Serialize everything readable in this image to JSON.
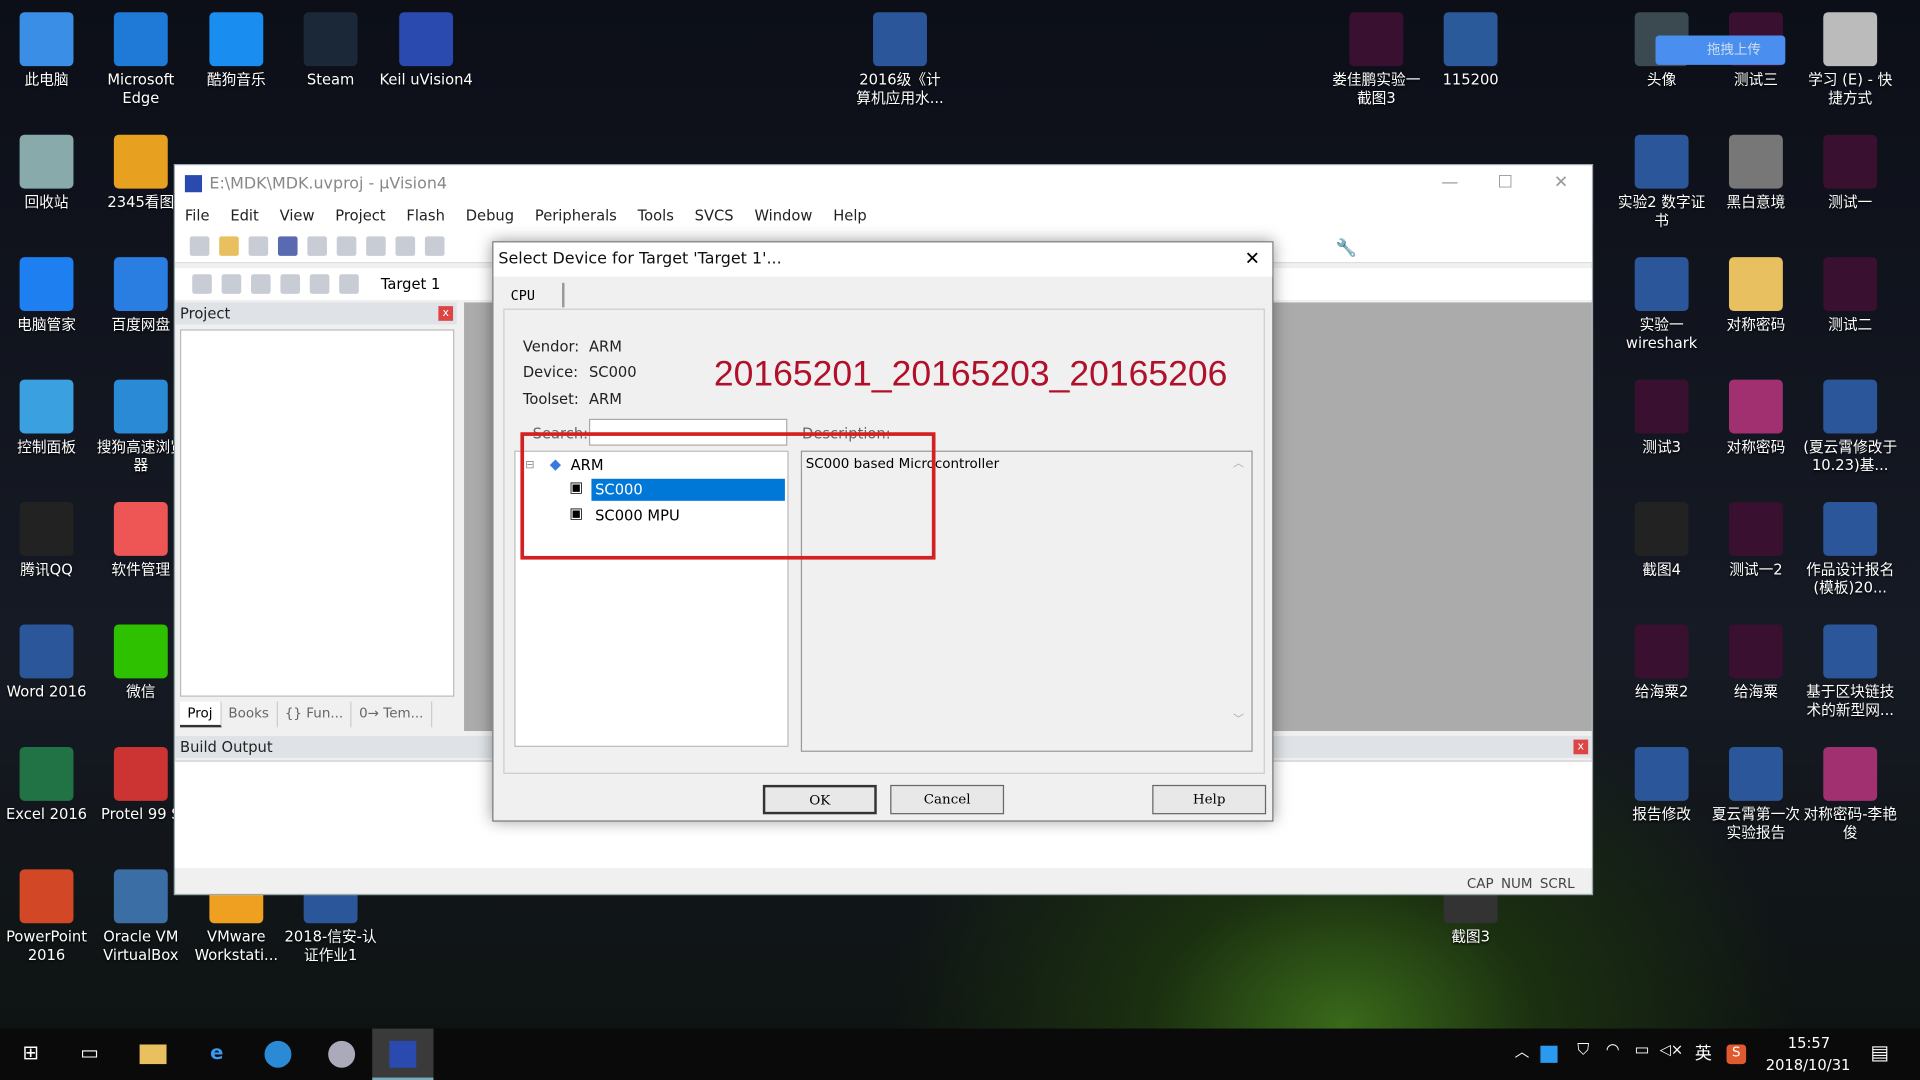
{
  "desktop": {
    "icons": [
      {
        "label": "此电脑",
        "icon": "computer-icon",
        "color": "#3a8ee6"
      },
      {
        "label": "回收站",
        "icon": "recycle-bin-icon",
        "color": "#8aa"
      },
      {
        "label": "电脑管家",
        "icon": "shield-icon",
        "color": "#1e7ff0"
      },
      {
        "label": "控制面板",
        "icon": "control-panel-icon",
        "color": "#3aa0e0"
      },
      {
        "label": "腾讯QQ",
        "icon": "qq-icon",
        "color": "#222"
      },
      {
        "label": "Word 2016",
        "icon": "word-icon",
        "color": "#2b579a"
      },
      {
        "label": "Excel 2016",
        "icon": "excel-icon",
        "color": "#217346"
      },
      {
        "label": "PowerPoint 2016",
        "icon": "powerpoint-icon",
        "color": "#d24726"
      },
      {
        "label": "Microsoft Edge",
        "icon": "edge-icon",
        "color": "#1e7ad6"
      },
      {
        "label": "2345看图",
        "icon": "image-viewer-icon",
        "color": "#e8a020"
      },
      {
        "label": "百度网盘",
        "icon": "baidu-pan-icon",
        "color": "#2a7de1"
      },
      {
        "label": "搜狗高速浏览器",
        "icon": "sogou-browser-icon",
        "color": "#2a8ad6"
      },
      {
        "label": "软件管理",
        "icon": "software-manager-icon",
        "color": "#e55"
      },
      {
        "label": "微信",
        "icon": "wechat-icon",
        "color": "#2dc100"
      },
      {
        "label": "Protel 99 S",
        "icon": "protel-icon",
        "color": "#c33"
      },
      {
        "label": "Oracle VM VirtualBox",
        "icon": "virtualbox-icon",
        "color": "#3a6ea5"
      },
      {
        "label": "酷狗音乐",
        "icon": "kugou-icon",
        "color": "#1a8ef0"
      },
      {
        "label": "VMware Workstati...",
        "icon": "vmware-icon",
        "color": "#f0a020"
      },
      {
        "label": "Steam",
        "icon": "steam-icon",
        "color": "#1b2838"
      },
      {
        "label": "2018-信安-认证作业1",
        "icon": "word-doc-icon",
        "color": "#2b579a"
      },
      {
        "label": "Keil uVision4",
        "icon": "keil-icon",
        "color": "#2a4ab0"
      },
      {
        "label": "2016级《计算机应用水...",
        "icon": "word-doc-icon",
        "color": "#2b579a"
      },
      {
        "label": "娄佳鹏实验一截图3",
        "icon": "screenshot-icon",
        "color": "#3a1030"
      },
      {
        "label": "115200",
        "icon": "screenshot-icon",
        "color": "#2a5a9a"
      },
      {
        "label": "截图3",
        "icon": "screenshot-icon",
        "color": "#333"
      },
      {
        "label": "头像",
        "icon": "image-icon",
        "color": "#3a4a50"
      },
      {
        "label": "实验2 数字证书",
        "icon": "word-doc-icon",
        "color": "#2b579a"
      },
      {
        "label": "实验一 wireshark",
        "icon": "word-doc-icon",
        "color": "#2b579a"
      },
      {
        "label": "测试3",
        "icon": "screenshot-icon",
        "color": "#3a1030"
      },
      {
        "label": "截图4",
        "icon": "screenshot-icon",
        "color": "#222"
      },
      {
        "label": "给海粟2",
        "icon": "screenshot-icon",
        "color": "#3a1030"
      },
      {
        "label": "报告修改",
        "icon": "word-doc-icon",
        "color": "#2b579a"
      },
      {
        "label": "测试三",
        "icon": "screenshot-icon",
        "color": "#3a1030"
      },
      {
        "label": "黑白意境",
        "icon": "image-icon",
        "color": "#777"
      },
      {
        "label": "对称密码",
        "icon": "folder-icon",
        "color": "#e8c060"
      },
      {
        "label": "对称密码",
        "icon": "rar-icon",
        "color": "#a03070"
      },
      {
        "label": "测试一2",
        "icon": "screenshot-icon",
        "color": "#3a1030"
      },
      {
        "label": "给海粟",
        "icon": "screenshot-icon",
        "color": "#3a1030"
      },
      {
        "label": "夏云霄第一次实验报告",
        "icon": "word-doc-icon",
        "color": "#2b579a"
      },
      {
        "label": "学习 (E) - 快捷方式",
        "icon": "drive-icon",
        "color": "#bbb"
      },
      {
        "label": "测试一",
        "icon": "screenshot-icon",
        "color": "#3a1030"
      },
      {
        "label": "测试二",
        "icon": "screenshot-icon",
        "color": "#3a1030"
      },
      {
        "label": "(夏云霄修改于10.23)基...",
        "icon": "word-doc-icon",
        "color": "#2b579a"
      },
      {
        "label": "作品设计报名(模板)20...",
        "icon": "word-doc-icon",
        "color": "#2b579a"
      },
      {
        "label": "基于区块链技术的新型网...",
        "icon": "word-doc-icon",
        "color": "#2b579a"
      },
      {
        "label": "对称密码-李艳俊",
        "icon": "rar-icon",
        "color": "#a03070"
      }
    ],
    "upload_widget": "拖拽上传"
  },
  "uvision": {
    "title": "E:\\MDK\\MDK.uvproj - µVision4",
    "menu": [
      "File",
      "Edit",
      "View",
      "Project",
      "Flash",
      "Debug",
      "Peripherals",
      "Tools",
      "SVCS",
      "Window",
      "Help"
    ],
    "target": "Target 1",
    "project_panel": "Project",
    "panel_tabs": [
      "Proj",
      "Books",
      "{} Fun...",
      "0→ Tem..."
    ],
    "build_output": "Build Output",
    "status": [
      "CAP",
      "NUM",
      "SCRL"
    ]
  },
  "dialog": {
    "title": "Select Device for Target 'Target 1'...",
    "tab": "CPU",
    "vendor_label": "Vendor:",
    "vendor": "ARM",
    "device_label": "Device:",
    "device": "SC000",
    "toolset_label": "Toolset:",
    "toolset": "ARM",
    "search_label": "Search:",
    "search_value": "",
    "description_label": "Description:",
    "description": "SC000 based Microcontroller",
    "tree": {
      "root": "ARM",
      "children": [
        "SC000",
        "SC000 MPU"
      ],
      "selected": "SC000"
    },
    "ok": "OK",
    "cancel": "Cancel",
    "help": "Help",
    "annotation": "20165201_20165203_20165206",
    "annotation_color": "#b0102a",
    "highlight_color": "#d42020",
    "selection_color": "#0078d7"
  },
  "taskbar": {
    "time": "15:57",
    "date": "2018/10/31",
    "ime": "英"
  }
}
